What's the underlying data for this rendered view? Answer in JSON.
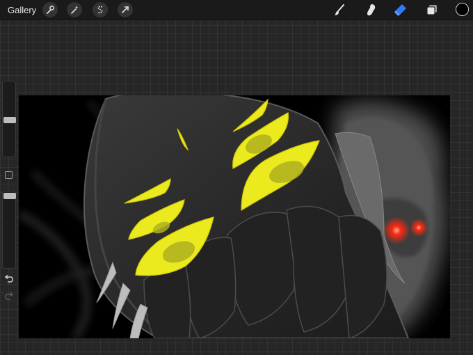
{
  "toolbar": {
    "gallery_label": "Gallery",
    "left_tools": [
      {
        "name": "actions-wrench-icon"
      },
      {
        "name": "adjustments-wand-icon"
      },
      {
        "name": "selection-s-icon"
      },
      {
        "name": "transform-arrow-icon"
      }
    ],
    "right_tools": [
      {
        "name": "brush-icon",
        "active": false
      },
      {
        "name": "smudge-icon",
        "active": false
      },
      {
        "name": "eraser-icon",
        "active": true
      },
      {
        "name": "layers-icon",
        "active": false
      }
    ],
    "current_color": "#000000"
  },
  "sidebar": {
    "brush_size": 0.48,
    "brush_opacity": 0.98
  },
  "colors": {
    "accent_blue": "#2f7bf6",
    "canvas_yellow": "#eaea1f",
    "canvas_red": "#ff2a10"
  }
}
